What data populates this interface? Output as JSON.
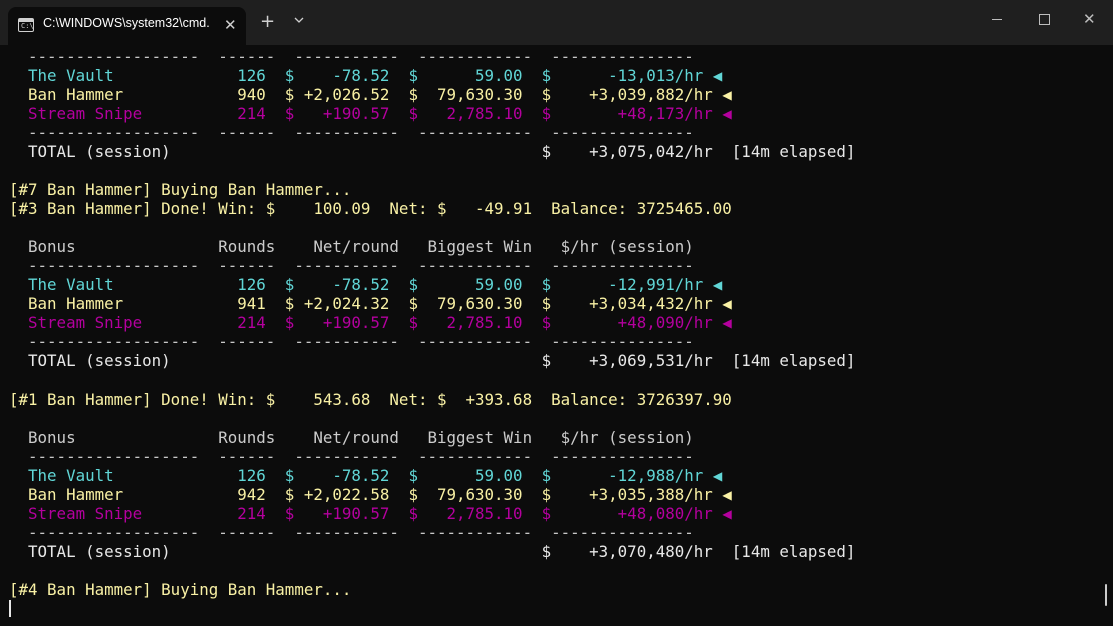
{
  "window": {
    "tab_title": "C:\\WINDOWS\\system32\\cmd.",
    "tab_icon_text": "C:\\",
    "tab_close": "✕",
    "new_tab": "+",
    "close_glyph": "✕",
    "colors": {
      "background": "#0c0c0c",
      "titlebar": "#1f1f1f",
      "cyan": "#61d6d6",
      "yellow": "#f9f1a5",
      "magenta": "#b4009e",
      "white": "#e8e8e8"
    }
  },
  "terminal": {
    "lines": [
      {
        "text": "  ------------------  ------  -----------  ------------  ---------------",
        "color": "dash"
      },
      {
        "text": "  The Vault             126  $    -78.52  $      59.00  $      -13,013/hr ◀",
        "color": "cyan"
      },
      {
        "text": "  Ban Hammer            940  $ +2,026.52  $  79,630.30  $    +3,039,882/hr ◀",
        "color": "yellow"
      },
      {
        "text": "  Stream Snipe          214  $   +190.57  $   2,785.10  $       +48,173/hr ◀",
        "color": "magenta"
      },
      {
        "text": "  ------------------  ------  -----------  ------------  ---------------",
        "color": "dash"
      },
      {
        "text": "  TOTAL (session)                                       $    +3,075,042/hr  [14m elapsed]",
        "color": "white"
      },
      {
        "text": "",
        "color": "white"
      },
      {
        "text": "[#7 Ban Hammer] Buying Ban Hammer...",
        "color": "yellow"
      },
      {
        "text": "[#3 Ban Hammer] Done! Win: $    100.09  Net: $   -49.91  Balance: 3725465.00",
        "color": "yellow"
      },
      {
        "text": "",
        "color": "white"
      },
      {
        "text": "  Bonus               Rounds    Net/round   Biggest Win   $/hr (session)",
        "color": "head"
      },
      {
        "text": "  ------------------  ------  -----------  ------------  ---------------",
        "color": "dash"
      },
      {
        "text": "  The Vault             126  $    -78.52  $      59.00  $      -12,991/hr ◀",
        "color": "cyan"
      },
      {
        "text": "  Ban Hammer            941  $ +2,024.32  $  79,630.30  $    +3,034,432/hr ◀",
        "color": "yellow"
      },
      {
        "text": "  Stream Snipe          214  $   +190.57  $   2,785.10  $       +48,090/hr ◀",
        "color": "magenta"
      },
      {
        "text": "  ------------------  ------  -----------  ------------  ---------------",
        "color": "dash"
      },
      {
        "text": "  TOTAL (session)                                       $    +3,069,531/hr  [14m elapsed]",
        "color": "white"
      },
      {
        "text": "",
        "color": "white"
      },
      {
        "text": "[#1 Ban Hammer] Done! Win: $    543.68  Net: $  +393.68  Balance: 3726397.90",
        "color": "yellow"
      },
      {
        "text": "",
        "color": "white"
      },
      {
        "text": "  Bonus               Rounds    Net/round   Biggest Win   $/hr (session)",
        "color": "head"
      },
      {
        "text": "  ------------------  ------  -----------  ------------  ---------------",
        "color": "dash"
      },
      {
        "text": "  The Vault             126  $    -78.52  $      59.00  $      -12,988/hr ◀",
        "color": "cyan"
      },
      {
        "text": "  Ban Hammer            942  $ +2,022.58  $  79,630.30  $    +3,035,388/hr ◀",
        "color": "yellow"
      },
      {
        "text": "  Stream Snipe          214  $   +190.57  $   2,785.10  $       +48,080/hr ◀",
        "color": "magenta"
      },
      {
        "text": "  ------------------  ------  -----------  ------------  ---------------",
        "color": "dash"
      },
      {
        "text": "  TOTAL (session)                                       $    +3,070,480/hr  [14m elapsed]",
        "color": "white"
      },
      {
        "text": "",
        "color": "white"
      },
      {
        "text": "[#4 Ban Hammer] Buying Ban Hammer...",
        "color": "yellow"
      }
    ]
  }
}
